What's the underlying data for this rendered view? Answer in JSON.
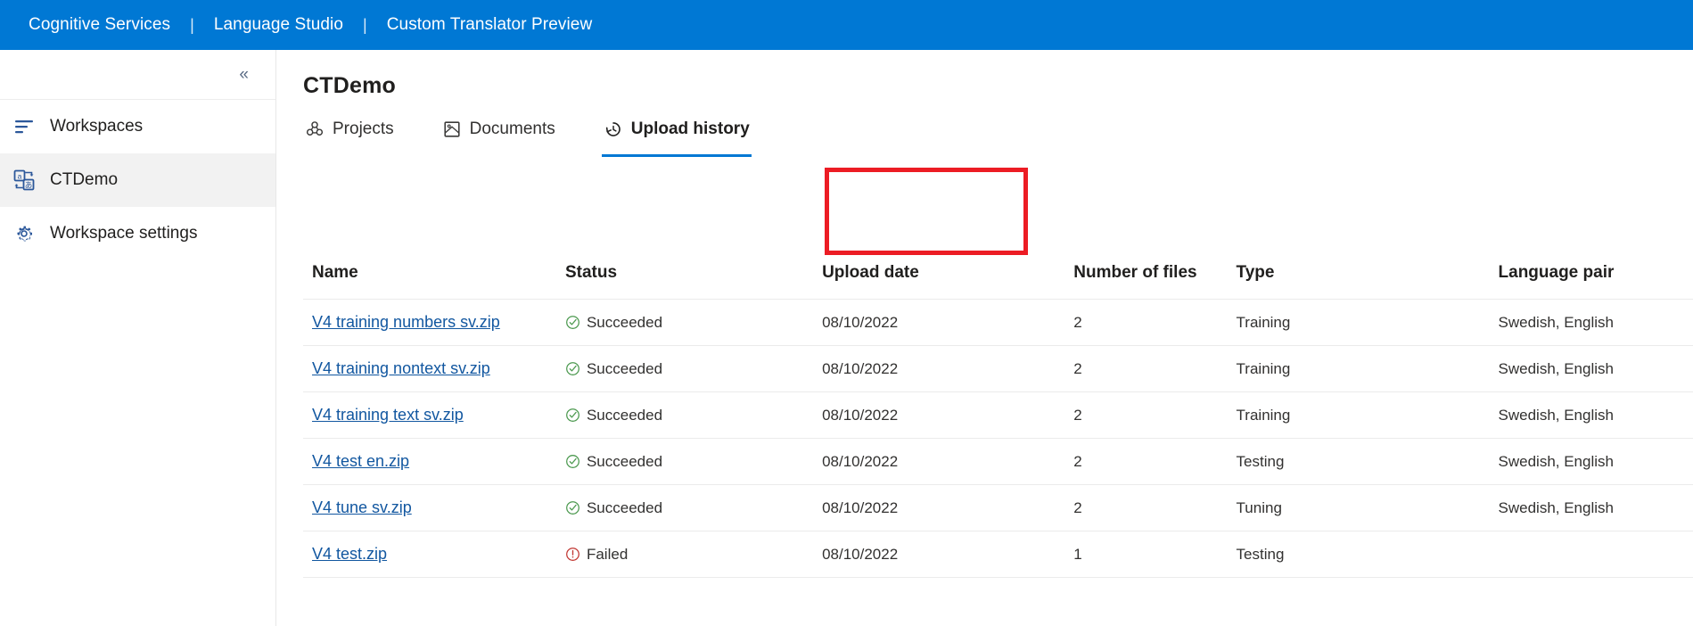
{
  "topbar": {
    "items": [
      {
        "label": "Cognitive Services"
      },
      {
        "label": "Language Studio"
      },
      {
        "label": "Custom Translator Preview"
      }
    ],
    "separator": "|",
    "background": "#0078d4"
  },
  "sidebar": {
    "collapse_label": "«",
    "items": [
      {
        "label": "Workspaces",
        "icon": "list-icon",
        "selected": false
      },
      {
        "label": "CTDemo",
        "icon": "translator-icon",
        "selected": true
      },
      {
        "label": "Workspace settings",
        "icon": "gear-icon",
        "selected": false
      }
    ]
  },
  "main": {
    "title": "CTDemo",
    "tabs": [
      {
        "label": "Projects",
        "icon": "projects-icon",
        "active": false
      },
      {
        "label": "Documents",
        "icon": "documents-icon",
        "active": false
      },
      {
        "label": "Upload history",
        "icon": "history-clock-icon",
        "active": true
      }
    ],
    "highlight_color": "#ec1c24",
    "accent_color": "#0078d4",
    "link_color": "#1257a0",
    "success_color": "#4e9a51",
    "error_color": "#c23934",
    "table": {
      "columns": [
        "Name",
        "Status",
        "Upload date",
        "Number of files",
        "Type",
        "Language pair"
      ],
      "rows": [
        {
          "name": "V4 training numbers sv.zip",
          "status": "Succeeded",
          "status_icon": "check-circle-icon",
          "upload_date": "08/10/2022",
          "number_of_files": "2",
          "type": "Training",
          "language_pair": "Swedish, English"
        },
        {
          "name": "V4 training nontext sv.zip",
          "status": "Succeeded",
          "status_icon": "check-circle-icon",
          "upload_date": "08/10/2022",
          "number_of_files": "2",
          "type": "Training",
          "language_pair": "Swedish, English"
        },
        {
          "name": "V4 training text sv.zip",
          "status": "Succeeded",
          "status_icon": "check-circle-icon",
          "upload_date": "08/10/2022",
          "number_of_files": "2",
          "type": "Training",
          "language_pair": "Swedish, English"
        },
        {
          "name": "V4 test en.zip",
          "status": "Succeeded",
          "status_icon": "check-circle-icon",
          "upload_date": "08/10/2022",
          "number_of_files": "2",
          "type": "Testing",
          "language_pair": "Swedish, English"
        },
        {
          "name": "V4 tune sv.zip",
          "status": "Succeeded",
          "status_icon": "check-circle-icon",
          "upload_date": "08/10/2022",
          "number_of_files": "2",
          "type": "Tuning",
          "language_pair": "Swedish, English"
        },
        {
          "name": "V4 test.zip",
          "status": "Failed",
          "status_icon": "error-circle-icon",
          "upload_date": "08/10/2022",
          "number_of_files": "1",
          "type": "Testing",
          "language_pair": ""
        }
      ]
    }
  }
}
